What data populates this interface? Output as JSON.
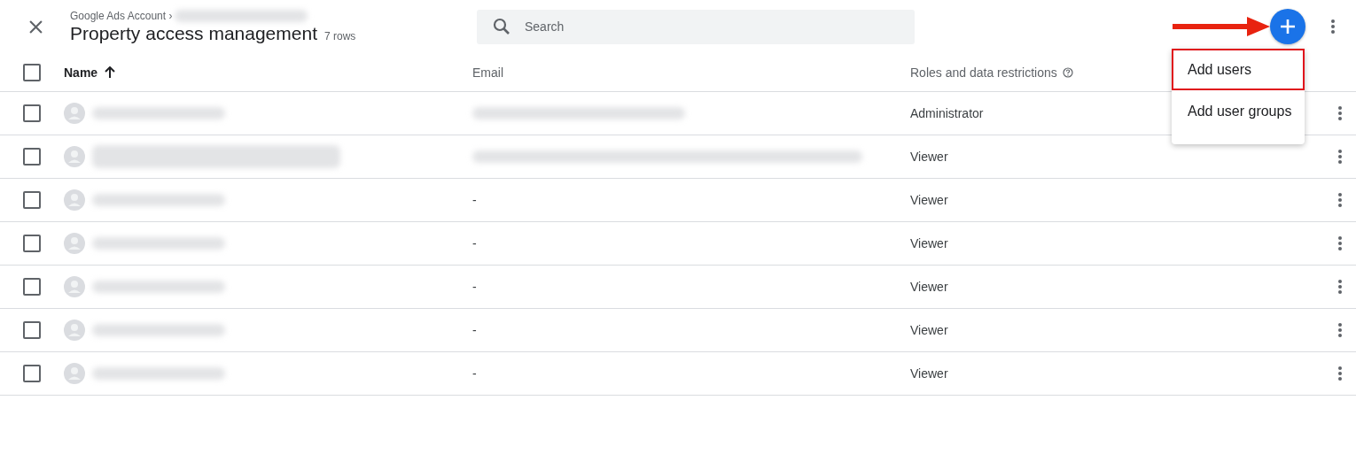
{
  "header": {
    "breadcrumb": "Google Ads Account ›",
    "breadcrumb_redacted": true,
    "title": "Property access management",
    "row_count": "7 rows",
    "search": {
      "placeholder": "Search"
    },
    "annotation_arrow": true
  },
  "table": {
    "select_all": {
      "checked": false
    },
    "columns": [
      {
        "label": "Name",
        "sorted": true
      },
      {
        "label": "Email"
      },
      {
        "label": "Roles and data restrictions",
        "help": true
      }
    ],
    "rows": [
      {
        "checked": false,
        "name": {
          "kind": "redacted"
        },
        "email": {
          "kind": "redacted"
        },
        "role": "Administrator"
      },
      {
        "checked": false,
        "name": {
          "kind": "redacted_two_line"
        },
        "email": {
          "kind": "redacted"
        },
        "role": "Viewer"
      },
      {
        "checked": false,
        "name": {
          "kind": "redacted"
        },
        "email": {
          "kind": "text",
          "text": "-"
        },
        "role": "Viewer"
      },
      {
        "checked": false,
        "name": {
          "kind": "redacted"
        },
        "email": {
          "kind": "text",
          "text": "-"
        },
        "role": "Viewer"
      },
      {
        "checked": false,
        "name": {
          "kind": "redacted"
        },
        "email": {
          "kind": "text",
          "text": "-"
        },
        "role": "Viewer"
      },
      {
        "checked": false,
        "name": {
          "kind": "redacted"
        },
        "email": {
          "kind": "text",
          "text": "-"
        },
        "role": "Viewer"
      },
      {
        "checked": false,
        "name": {
          "kind": "redacted"
        },
        "email": {
          "kind": "text",
          "text": "-"
        },
        "role": "Viewer"
      }
    ]
  },
  "add_menu": {
    "items": [
      {
        "label": "Add users",
        "highlighted": true
      },
      {
        "label": "Add user groups",
        "highlighted": false
      }
    ]
  }
}
